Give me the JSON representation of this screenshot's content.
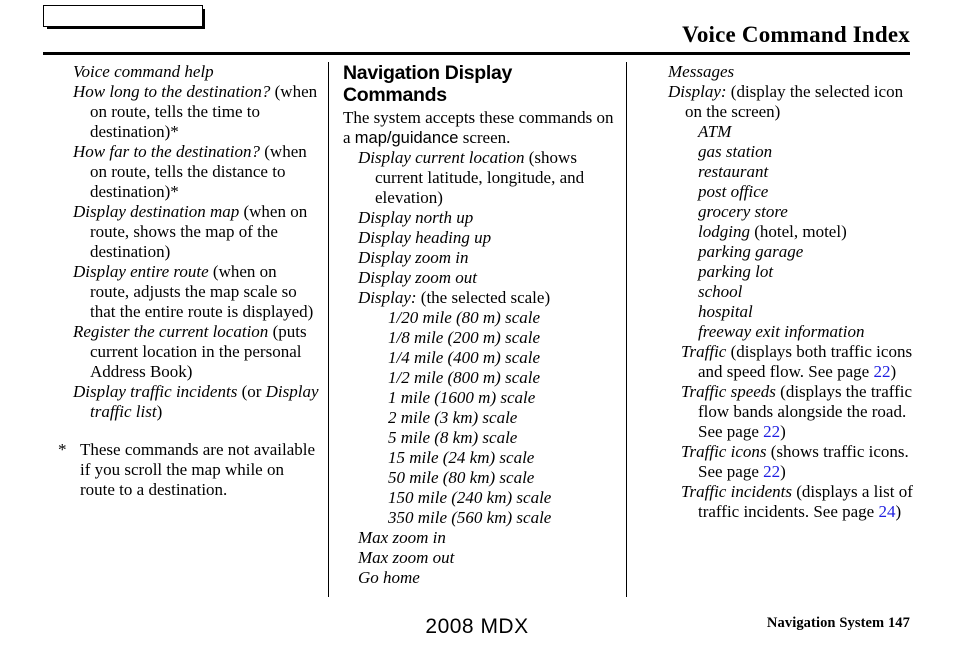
{
  "header": {
    "tab_box_label": "",
    "title": "Voice Command Index"
  },
  "columns": {
    "left": {
      "items": [
        {
          "cmd": "Voice command help",
          "note": ""
        },
        {
          "cmd": "How long to the destination?",
          "note": " (when on route, tells the time to destination)*"
        },
        {
          "cmd": "How far to the destination?",
          "note": " (when on route, tells the distance to destination)*"
        },
        {
          "cmd": "Display destination map",
          "note": " (when on route, shows the map of the destination)"
        },
        {
          "cmd": "Display entire route",
          "note": " (when on route, adjusts the map scale so that the entire route is displayed)"
        },
        {
          "cmd": "Register the current location",
          "note": " (puts current location in the personal Address Book)"
        },
        {
          "cmd": "Display traffic incidents",
          "note": " (or ",
          "cmd2": "Display traffic list",
          "note2": ")"
        }
      ],
      "footnote_marker": "*",
      "footnote_text": "These commands are not available if you scroll the map while on route to a destination."
    },
    "middle": {
      "heading": "Navigation Display Commands",
      "intro_before": "The system accepts these commands on a ",
      "intro_sans": "map/guidance",
      "intro_after": " screen.",
      "items": [
        {
          "cmd": "Display current location",
          "note": " (shows current latitude, longitude, and elevation)"
        },
        {
          "cmd": "Display north up",
          "note": ""
        },
        {
          "cmd": "Display heading up",
          "note": ""
        },
        {
          "cmd": "Display zoom in",
          "note": ""
        },
        {
          "cmd": "Display zoom out",
          "note": ""
        },
        {
          "cmd": "Display:",
          "note": " (the selected scale)"
        }
      ],
      "scales": [
        "1/20 mile (80 m) scale",
        "1/8 mile (200 m) scale",
        "1/4 mile (400 m) scale",
        "1/2 mile (800 m) scale",
        "1 mile (1600 m) scale",
        "2 mile (3 km) scale",
        "5 mile (8 km) scale",
        "15 mile (24 km) scale",
        "50 mile (80 km) scale",
        "150 mile (240 km) scale",
        "350 mile (560 km) scale"
      ],
      "trailing_items": [
        "Max zoom in",
        "Max zoom out",
        "Go home"
      ]
    },
    "right": {
      "heading": "Messages",
      "display_cmd": "Display:",
      "display_note": " (display the selected icon on the screen)",
      "icons": [
        {
          "name": "ATM",
          "note": ""
        },
        {
          "name": "gas station",
          "note": ""
        },
        {
          "name": "restaurant",
          "note": ""
        },
        {
          "name": "post office",
          "note": ""
        },
        {
          "name": "grocery store",
          "note": ""
        },
        {
          "name": "lodging",
          "note": " (hotel, motel)"
        },
        {
          "name": "parking garage",
          "note": ""
        },
        {
          "name": "parking lot",
          "note": ""
        },
        {
          "name": "school",
          "note": ""
        },
        {
          "name": "hospital",
          "note": ""
        },
        {
          "name": "freeway exit information",
          "note": ""
        }
      ],
      "traffic": [
        {
          "cmd": "Traffic",
          "note_before": " (displays both traffic icons and speed flow. See page ",
          "page": "22",
          "note_after": ")"
        },
        {
          "cmd": "Traffic speeds",
          "note_before": " (displays the traffic flow bands alongside the road. See page ",
          "page": "22",
          "note_after": ")"
        },
        {
          "cmd": "Traffic icons",
          "note_before": " (shows traffic icons. See page ",
          "page": "22",
          "note_after": ")"
        },
        {
          "cmd": "Traffic incidents",
          "note_before": " (displays a list of traffic incidents. See page ",
          "page": "24",
          "note_after": ")"
        }
      ]
    }
  },
  "footer": {
    "center": "2008  MDX",
    "right": "Navigation System  147"
  },
  "colors": {
    "link_blue": "#1e1ee0",
    "text": "#000000",
    "background": "#ffffff"
  }
}
